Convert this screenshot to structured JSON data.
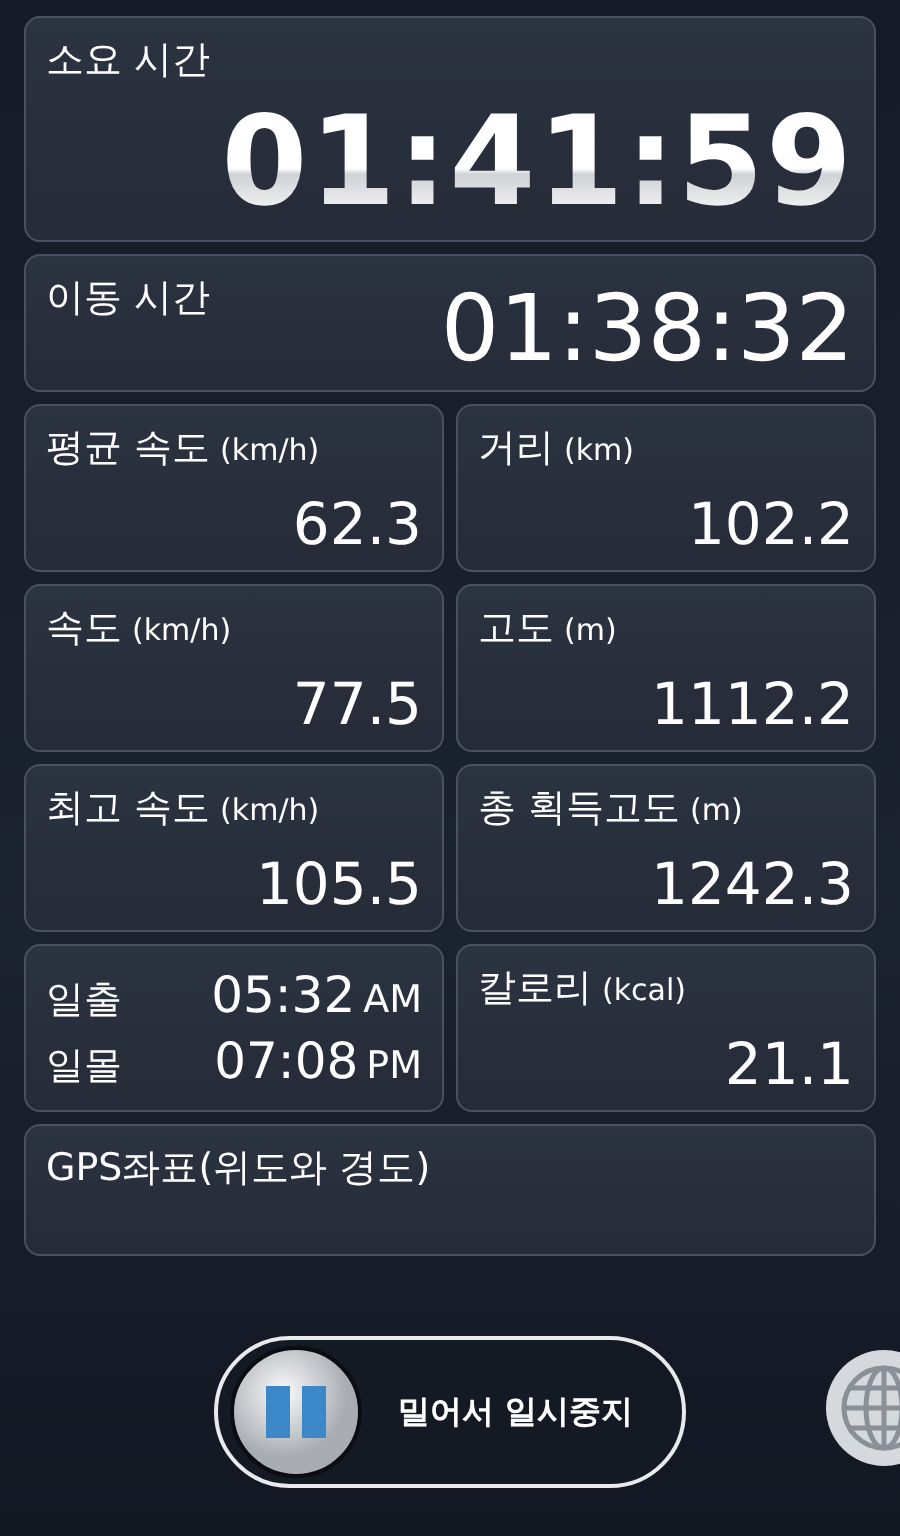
{
  "total_time": {
    "label": "소요 시간",
    "value": "01:41:59"
  },
  "moving_time": {
    "label": "이동 시간",
    "value": "01:38:32"
  },
  "stats": [
    {
      "kind": "metric",
      "label": "평균 속도",
      "unit": "(km/h)",
      "value": "62.3"
    },
    {
      "kind": "metric",
      "label": "거리",
      "unit": "(km)",
      "value": "102.2"
    },
    {
      "kind": "metric",
      "label": "속도",
      "unit": "(km/h)",
      "value": "77.5"
    },
    {
      "kind": "metric",
      "label": "고도",
      "unit": "(m)",
      "value": "1112.2"
    },
    {
      "kind": "metric",
      "label": "최고 속도",
      "unit": "(km/h)",
      "value": "105.5"
    },
    {
      "kind": "metric",
      "label": "총 획득고도",
      "unit": "(m)",
      "value": "1242.3"
    },
    {
      "kind": "sun",
      "rows": [
        {
          "label": "일출",
          "time": "05:32",
          "suffix": "AM"
        },
        {
          "label": "일몰",
          "time": "07:08",
          "suffix": "PM"
        }
      ]
    },
    {
      "kind": "metric",
      "label": "칼로리",
      "unit": "(kcal)",
      "value": "21.1"
    }
  ],
  "gps": {
    "label": "GPS좌표(위도와 경도)"
  },
  "slider": {
    "label": "밀어서 일시중지",
    "level": 0
  }
}
